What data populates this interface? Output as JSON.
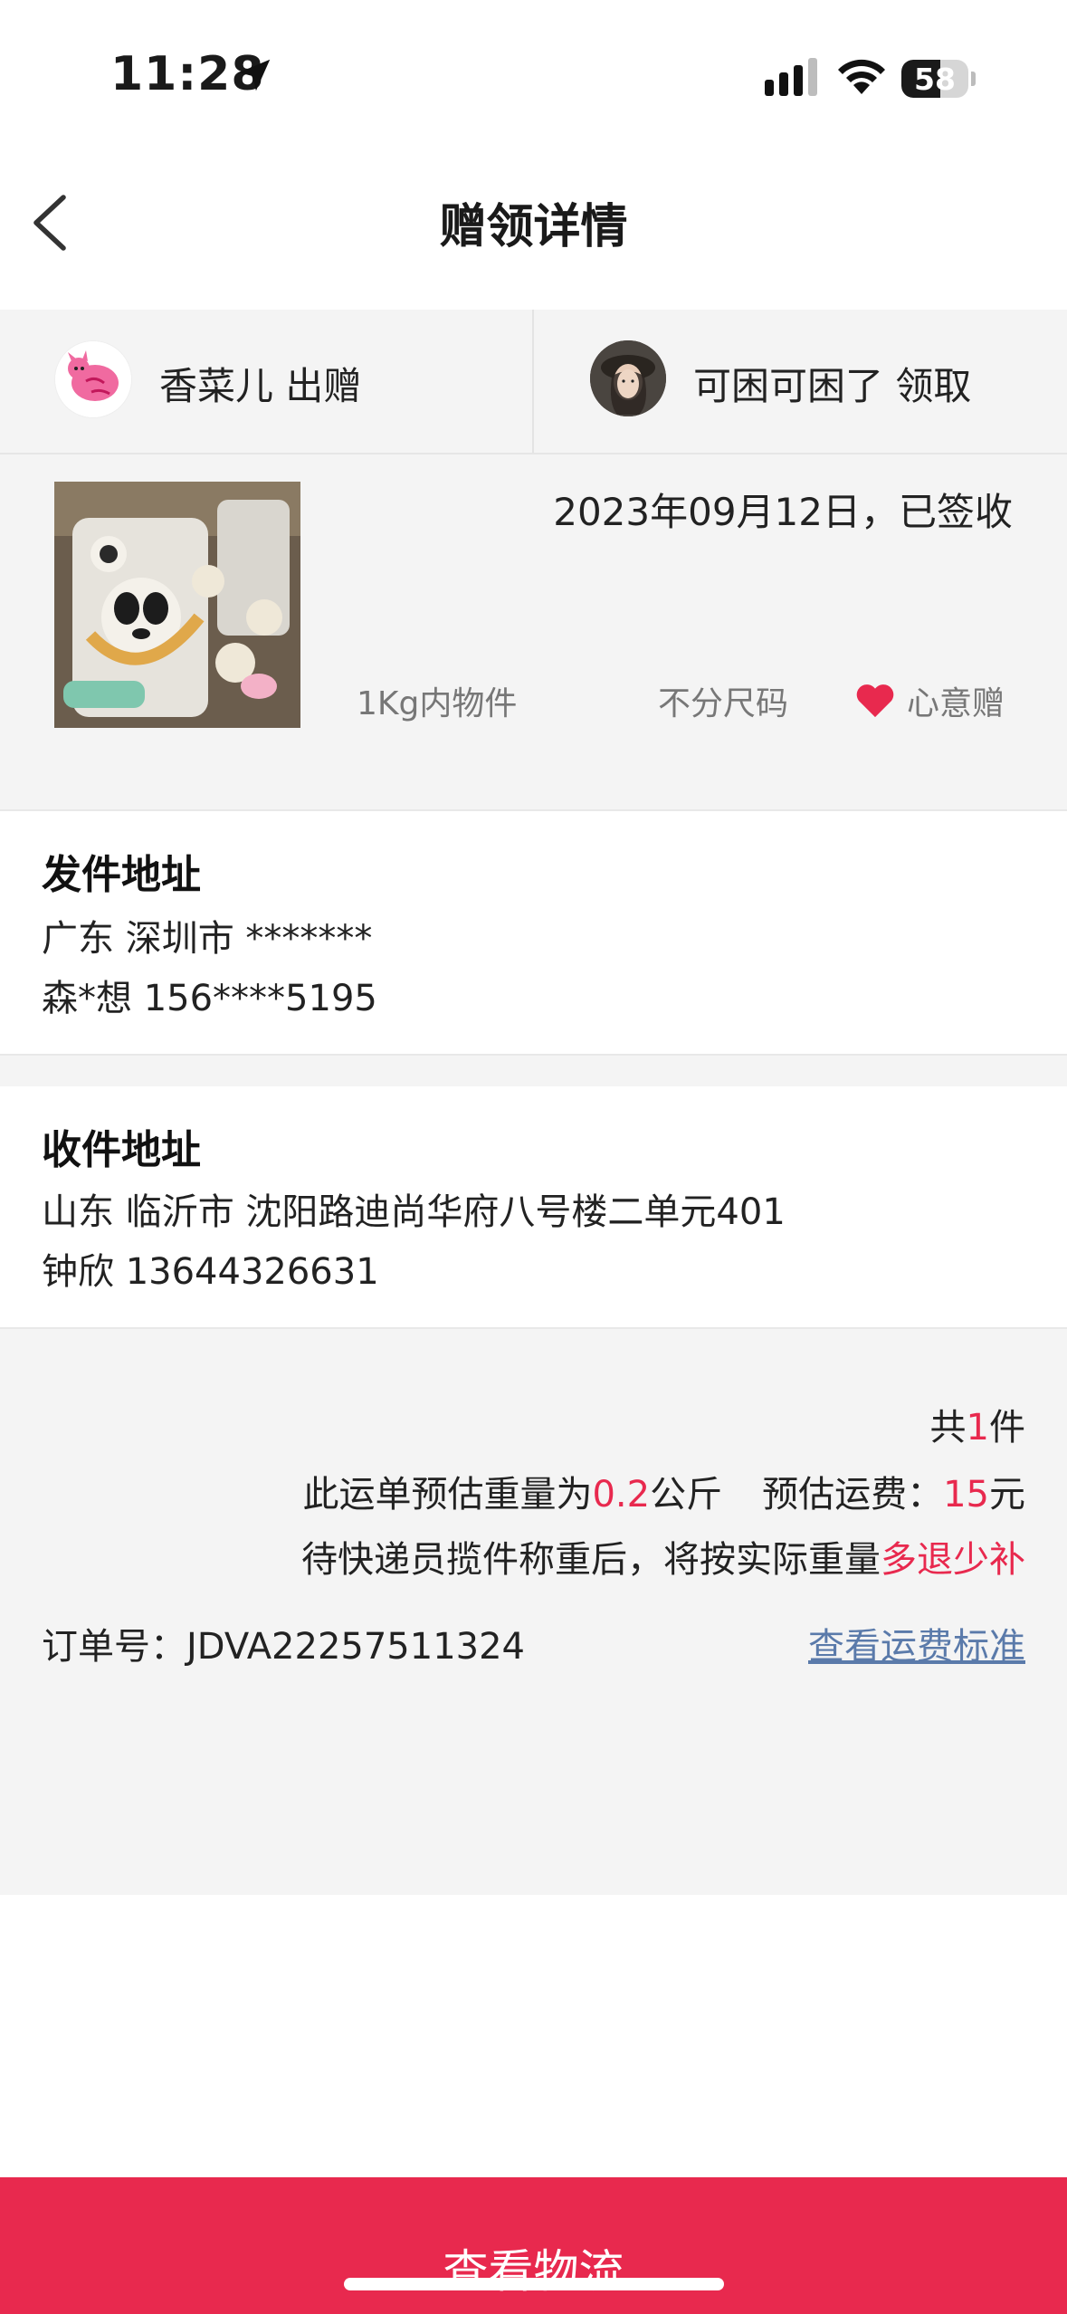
{
  "status_bar": {
    "time": "11:28",
    "battery": "58"
  },
  "nav": {
    "title": "赠领详情"
  },
  "users": {
    "giver": "香菜儿 出赠",
    "receiver": "可困可困了 领取"
  },
  "gift": {
    "date_status": "2023年09月12日，已签收",
    "weight_tag": "1Kg内物件",
    "size_tag": "不分尺码",
    "type_tag": "心意赠"
  },
  "sender": {
    "title": "发件地址",
    "address": "广东 深圳市 *******",
    "contact": "森*想 156****5195"
  },
  "receiver_address": {
    "title": "收件地址",
    "address": "山东 临沂市 沈阳路迪尚华府八号楼二单元401",
    "contact": "钟欣 13644326631"
  },
  "summary": {
    "count_prefix": "共",
    "count": "1",
    "count_suffix": "件",
    "weight_prefix": "此运单预估重量为",
    "weight": "0.2",
    "weight_suffix": "公斤",
    "fee_prefix": "预估运费：",
    "fee": "15",
    "fee_suffix": "元",
    "note_prefix": "待快递员揽件称重后，将按实际重量",
    "note_highlight": "多退少补",
    "order_label": "订单号：JDVA22257511324",
    "fee_standard_link": "查看运费标准"
  },
  "button": {
    "logistics": "查看物流"
  },
  "colors": {
    "accent": "#e8294e",
    "link": "#5a7aaa",
    "background": "#f4f4f4"
  }
}
